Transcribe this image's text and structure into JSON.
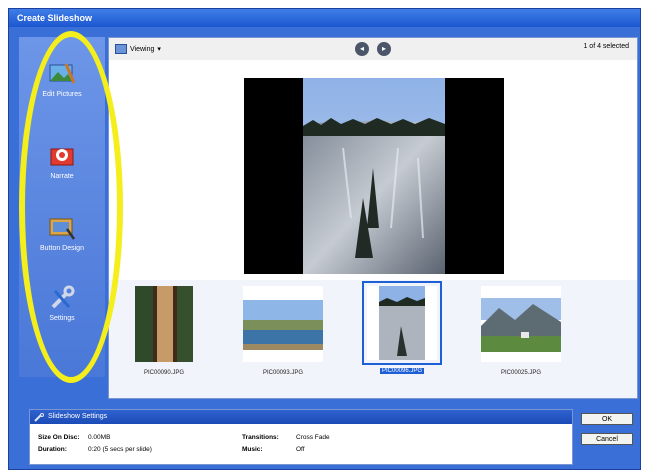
{
  "window": {
    "title": "Create Slideshow"
  },
  "sidebar": {
    "items": [
      {
        "label": "Edit Pictures",
        "icon": "edit-pictures-icon"
      },
      {
        "label": "Narrate",
        "icon": "narrate-icon"
      },
      {
        "label": "Button Design",
        "icon": "button-design-icon"
      },
      {
        "label": "Settings",
        "icon": "settings-icon"
      }
    ]
  },
  "toolbar": {
    "view_label": "Viewing",
    "selection_count": "1 of 4 selected"
  },
  "thumbnails": [
    {
      "caption": "PIC00090.JPG",
      "selected": false
    },
    {
      "caption": "PIC00093.JPG",
      "selected": false
    },
    {
      "caption": "PIC00096.JPG",
      "selected": true
    },
    {
      "caption": "PIC00025.JPG",
      "selected": false
    }
  ],
  "settings": {
    "title": "Slideshow Settings",
    "size_label": "Size On Disc:",
    "size_value": "0.00MB",
    "duration_label": "Duration:",
    "duration_value": "0:20 (5 secs per slide)",
    "transitions_label": "Transitions:",
    "transitions_value": "Cross Fade",
    "music_label": "Music:",
    "music_value": "Off"
  },
  "buttons": {
    "ok": "OK",
    "cancel": "Cancel"
  },
  "colors": {
    "highlight_oval": "#f3ee1c",
    "window_blue": "#3a6fd8",
    "selection_blue": "#1f5fd6"
  }
}
